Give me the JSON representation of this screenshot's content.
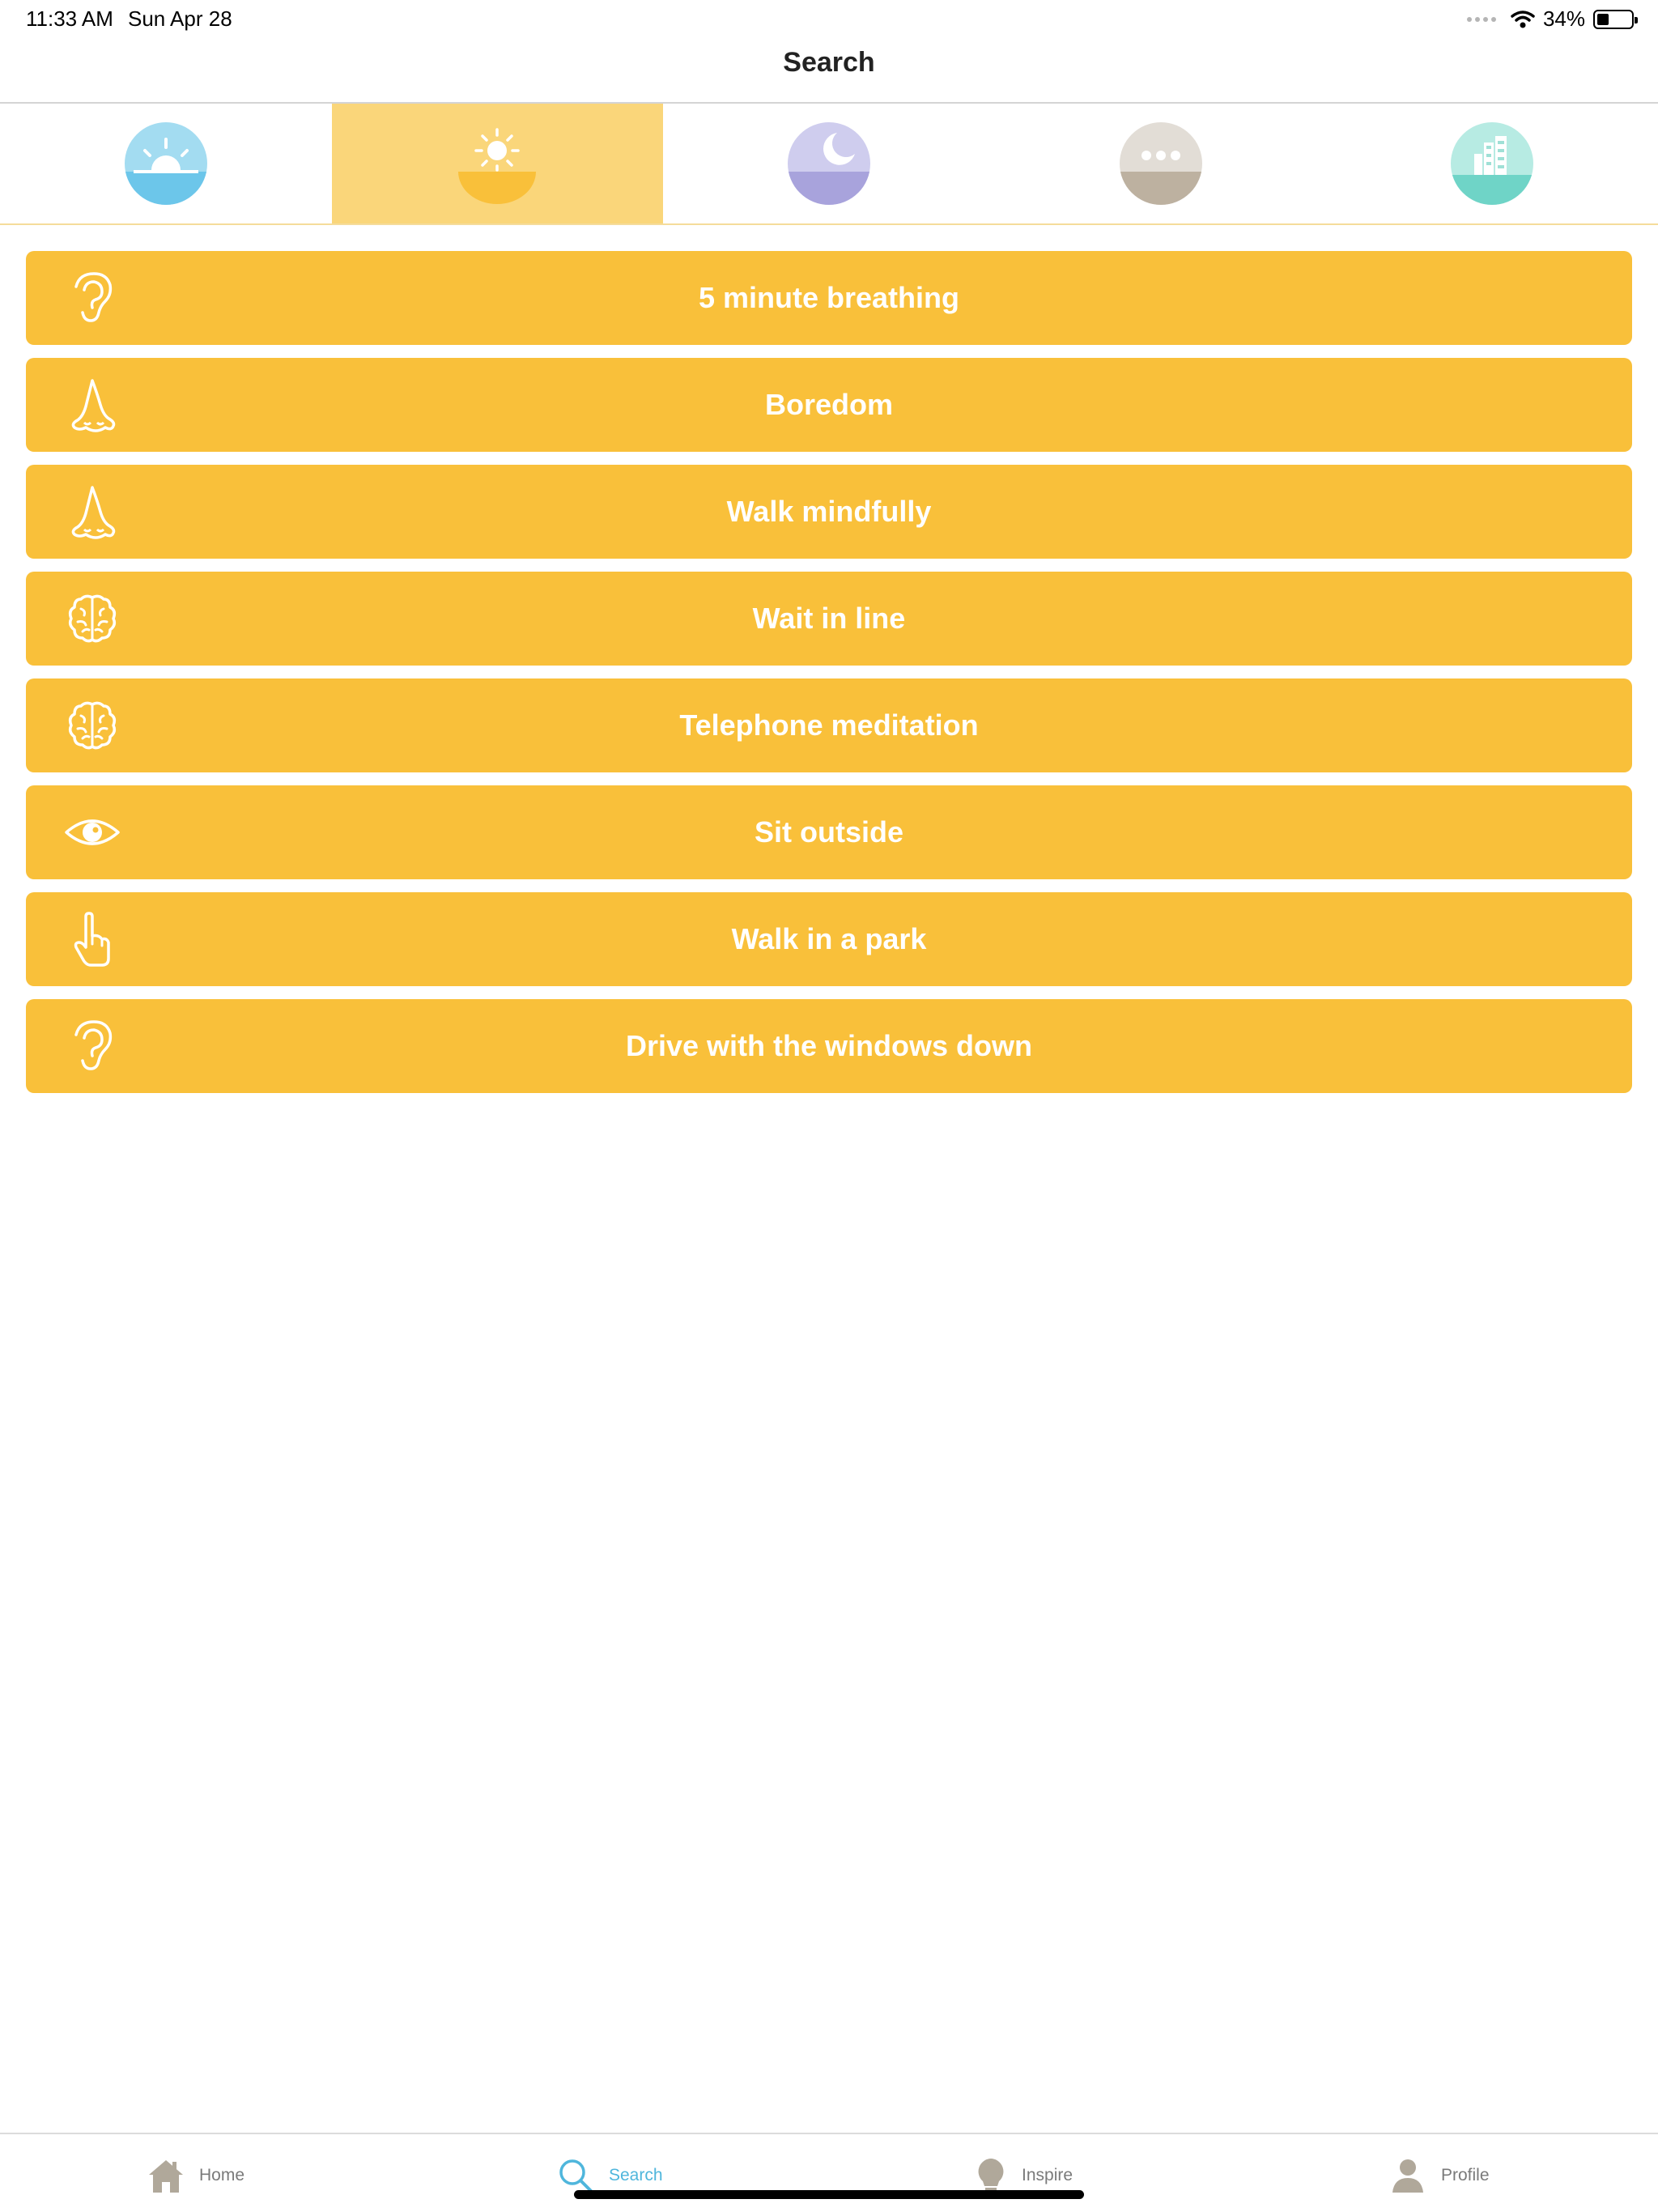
{
  "status_bar": {
    "time": "11:33 AM",
    "date": "Sun Apr 28",
    "battery_percent": "34%",
    "battery_level": 0.34
  },
  "nav": {
    "title": "Search"
  },
  "categories": [
    {
      "icon": "sunrise-icon",
      "color": "#6cc6ea",
      "selected": false
    },
    {
      "icon": "sun-icon",
      "color": "#f9c03a",
      "selected": true
    },
    {
      "icon": "moon-icon",
      "color": "#a8a3dc",
      "selected": false
    },
    {
      "icon": "more-dots-icon",
      "color": "#bdb1a0",
      "selected": false
    },
    {
      "icon": "city-icon",
      "color": "#6fd4c7",
      "selected": false
    }
  ],
  "activities": [
    {
      "label": "5 minute breathing",
      "icon": "ear-icon"
    },
    {
      "label": "Boredom",
      "icon": "nose-icon"
    },
    {
      "label": "Walk mindfully",
      "icon": "nose-icon"
    },
    {
      "label": "Wait in line",
      "icon": "brain-icon"
    },
    {
      "label": "Telephone meditation",
      "icon": "brain-icon"
    },
    {
      "label": "Sit outside",
      "icon": "eye-icon"
    },
    {
      "label": "Walk in a park",
      "icon": "pointing-hand-icon"
    },
    {
      "label": "Drive with the windows down",
      "icon": "ear-icon"
    }
  ],
  "tab_bar": {
    "home": "Home",
    "search": "Search",
    "inspire": "Inspire",
    "profile": "Profile",
    "active": "search",
    "active_color": "#4fb6dc"
  },
  "colors": {
    "accent_yellow": "#f9c03a",
    "selected_tab_bg": "#fad67a"
  }
}
